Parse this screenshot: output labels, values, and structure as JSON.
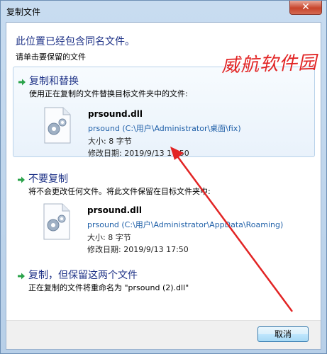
{
  "window": {
    "title": "复制文件",
    "close_label": "✕"
  },
  "header": {
    "heading": "此位置已经包含同名文件。",
    "instruction": "请单击要保留的文件"
  },
  "options": [
    {
      "title": "复制和替换",
      "description": "使用正在复制的文件替换目标文件夹中的文件:",
      "file": {
        "name": "prsound.dll",
        "path": "prsound (C:\\用户\\Administrator\\桌面\\fix)",
        "size": "大小: 8 字节",
        "modified": "修改日期: 2019/9/13 17:50"
      }
    },
    {
      "title": "不要复制",
      "description": "将不会更改任何文件。将此文件保留在目标文件夹中:",
      "file": {
        "name": "prsound.dll",
        "path": "prsound (C:\\用户\\Administrator\\AppData\\Roaming)",
        "size": "大小: 8 字节",
        "modified": "修改日期: 2019/9/13 17:50"
      }
    },
    {
      "title": "复制，但保留这两个文件",
      "description": "正在复制的文件将重命名为 \"prsound (2).dll\""
    }
  ],
  "footer": {
    "cancel_label": "取消"
  },
  "watermark": "威航软件园",
  "colors": {
    "accent": "#1e3287",
    "annotation": "#e22424",
    "arrow_green": "#2aa34a"
  }
}
